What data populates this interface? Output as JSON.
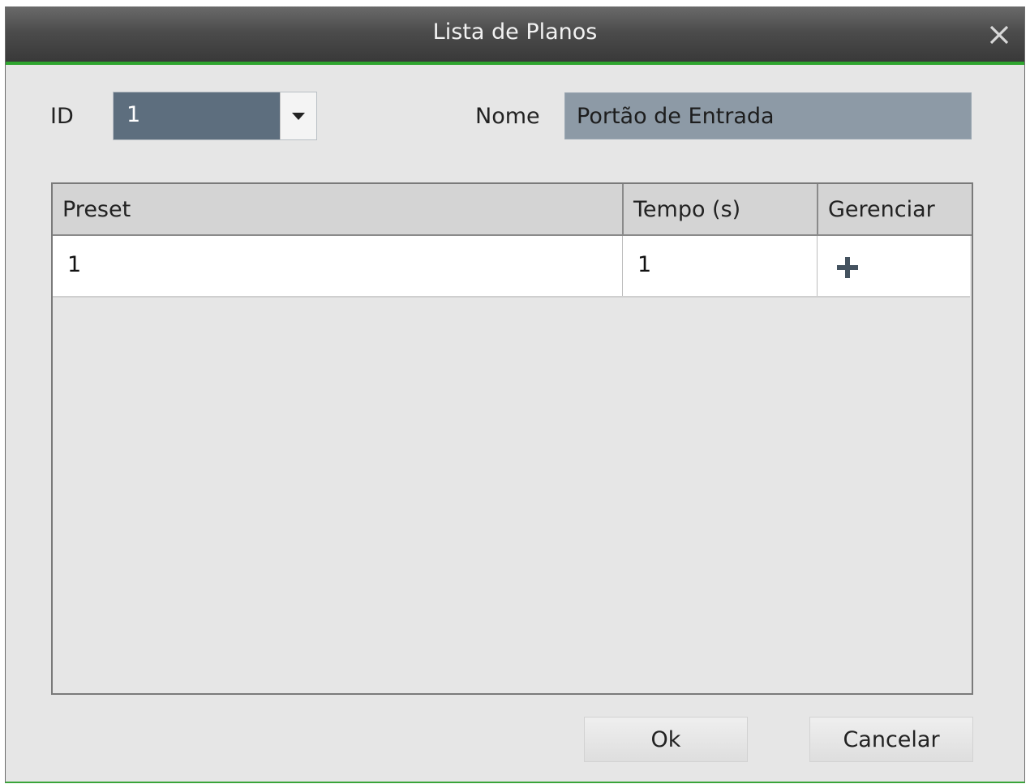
{
  "window": {
    "title": "Lista de Planos"
  },
  "form": {
    "id_label": "ID",
    "id_value": "1",
    "name_label": "Nome",
    "name_value": "Portão de Entrada"
  },
  "table": {
    "columns": [
      "Preset",
      "Tempo (s)",
      "Gerenciar"
    ],
    "rows": [
      {
        "preset": "1",
        "tempo": "1",
        "manage_icon": "plus-icon"
      }
    ]
  },
  "buttons": {
    "ok": "Ok",
    "cancel": "Cancelar"
  },
  "colors": {
    "accent": "#2fa52f",
    "title_bar": "#4c4c4c",
    "id_field": "#5d6e7e",
    "name_field": "#8d9aa6"
  },
  "icons": {
    "close": "close-icon",
    "dropdown": "chevron-down-icon",
    "add": "plus-icon"
  }
}
